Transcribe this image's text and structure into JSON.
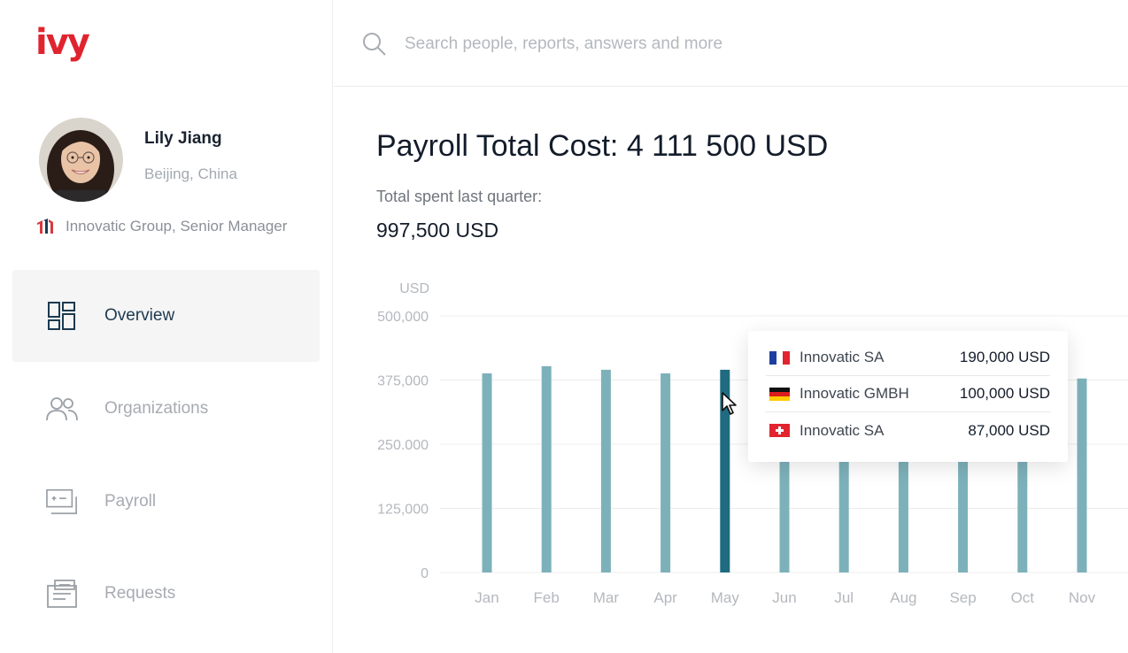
{
  "app": {
    "logo": "ivy"
  },
  "search": {
    "placeholder": "Search people, reports, answers and more"
  },
  "user": {
    "name": "Lily Jiang",
    "location": "Beijing, China",
    "company": "Innovatic Group, Senior Manager"
  },
  "sidebar": {
    "items": [
      {
        "label": "Overview",
        "icon": "grid-icon",
        "active": true
      },
      {
        "label": "Organizations",
        "icon": "people-icon",
        "active": false
      },
      {
        "label": "Payroll",
        "icon": "payroll-icon",
        "active": false
      },
      {
        "label": "Requests",
        "icon": "requests-icon",
        "active": false
      }
    ]
  },
  "main": {
    "title": "Payroll Total Cost: 4 111 500 USD",
    "sub_label": "Total spent last quarter:",
    "sub_value": "997,500 USD"
  },
  "chart_data": {
    "type": "bar",
    "ylabel": "USD",
    "ylim": [
      0,
      500000
    ],
    "y_ticks": [
      "0",
      "125,000",
      "250.000",
      "375,000",
      "500,000"
    ],
    "categories": [
      "Jan",
      "Feb",
      "Mar",
      "Apr",
      "May",
      "Jun",
      "Jul",
      "Aug",
      "Sep",
      "Oct",
      "Nov"
    ],
    "values": [
      388000,
      402000,
      395000,
      388000,
      395000,
      388000,
      388000,
      388000,
      388000,
      388000,
      378000
    ],
    "highlighted": "May",
    "colors": {
      "bar": "#7db1ba",
      "highlight": "#1f6b80",
      "grid": "#ececec",
      "tick": "#b4b8bd"
    }
  },
  "tooltip": {
    "rows": [
      {
        "flag": "france-flag",
        "name": "Innovatic SA",
        "value": "190,000 USD"
      },
      {
        "flag": "germany-flag",
        "name": "Innovatic GMBH",
        "value": "100,000 USD"
      },
      {
        "flag": "switzerland-flag",
        "name": "Innovatic SA",
        "value": "87,000 USD"
      }
    ]
  },
  "colors": {
    "brand": "#e0242f",
    "accent": "#1d3a4f"
  }
}
